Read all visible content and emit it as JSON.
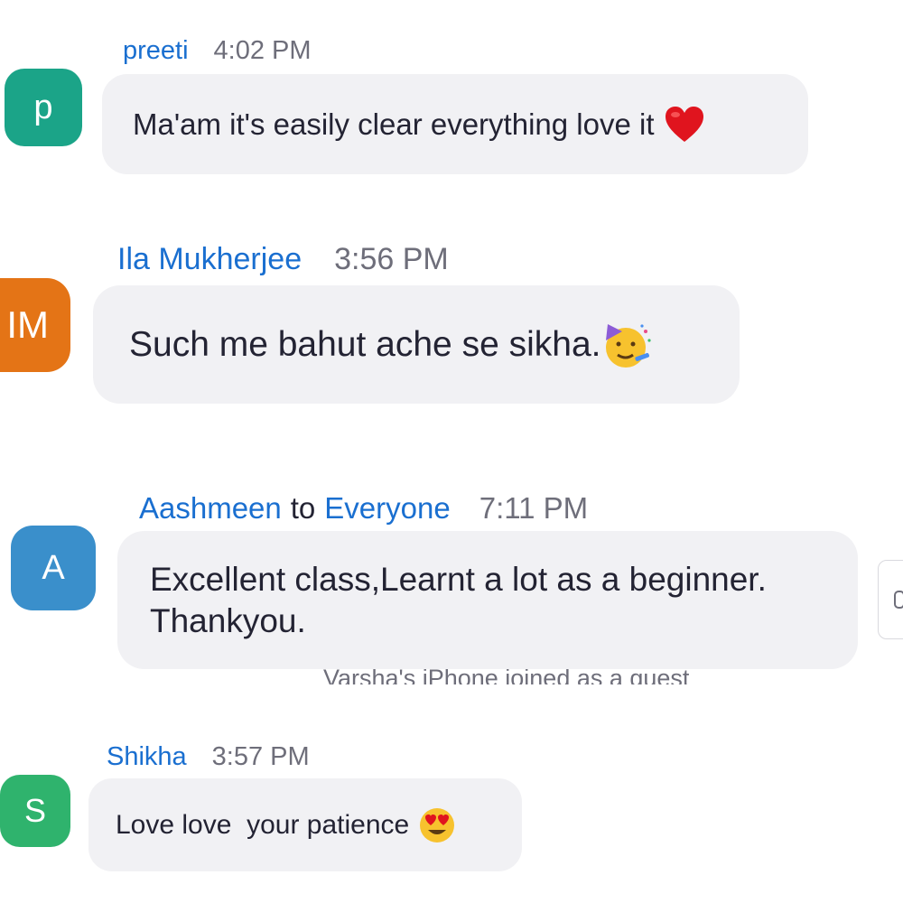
{
  "colors": {
    "name_blue": "#1a6fd0",
    "time_gray": "#6e6e7a",
    "text_dark": "#232333",
    "bubble_bg": "#f1f1f4",
    "avatar_p": "#1ba488",
    "avatar_im": "#e47416",
    "avatar_a": "#3a8fcb",
    "avatar_s": "#2fb36d"
  },
  "messages": [
    {
      "sender": "preeti",
      "time": "4:02 PM",
      "avatar_initials": "p",
      "text": "Ma'am it's easily clear everything love it",
      "emoji": "red-heart"
    },
    {
      "sender": "Ila Mukherjee",
      "time": "3:56 PM",
      "avatar_initials": "IM",
      "text": "Such me bahut ache se sikha.",
      "emoji": "partying-face"
    },
    {
      "sender": "Aashmeen",
      "to_word": "to",
      "recipient": "Everyone",
      "time": "7:11 PM",
      "avatar_initials": "A",
      "text_line1": "Excellent class,Learnt a lot as a beginner.",
      "text_line2": "Thankyou."
    },
    {
      "sender": "Shikha",
      "time": "3:57 PM",
      "avatar_initials": "S",
      "text": "Love love  your patience",
      "emoji": "heart-eyes"
    }
  ],
  "system_message": "Varsha's iPhone joined as a guest"
}
